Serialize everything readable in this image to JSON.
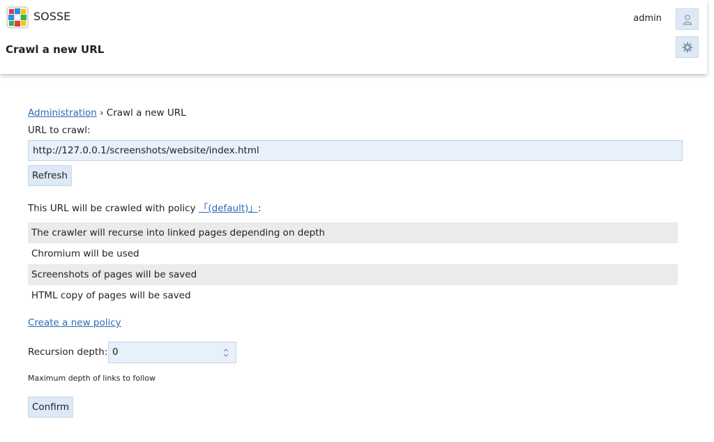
{
  "app": {
    "name": "SOSSE"
  },
  "header": {
    "page_title": "Crawl a new URL",
    "username": "admin"
  },
  "icons": {
    "user": "user-icon",
    "settings": "gear-icon",
    "logo": "sosse-logo-icon"
  },
  "breadcrumb": {
    "parent": "Administration",
    "separator": "›",
    "current": "Crawl a new URL"
  },
  "form": {
    "url_label": "URL to crawl:",
    "url_value": "http://127.0.0.1/screenshots/website/index.html",
    "refresh_label": "Refresh",
    "policy_prefix": "This URL will be crawled with policy",
    "policy_name": "「(default)」",
    "policy_suffix": ":",
    "policy_details": [
      "The crawler will recurse into linked pages depending on depth",
      "Chromium will be used",
      "Screenshots of pages will be saved",
      "HTML copy of pages will be saved"
    ],
    "create_policy_label": "Create a new policy",
    "depth_label": "Recursion depth:",
    "depth_value": "0",
    "depth_help": "Maximum depth of links to follow",
    "confirm_label": "Confirm"
  },
  "colors": {
    "link": "#2a6bb5",
    "button_bg": "#dde9f6",
    "input_bg": "#e8f0fb",
    "row_stripe": "#ebebeb"
  }
}
